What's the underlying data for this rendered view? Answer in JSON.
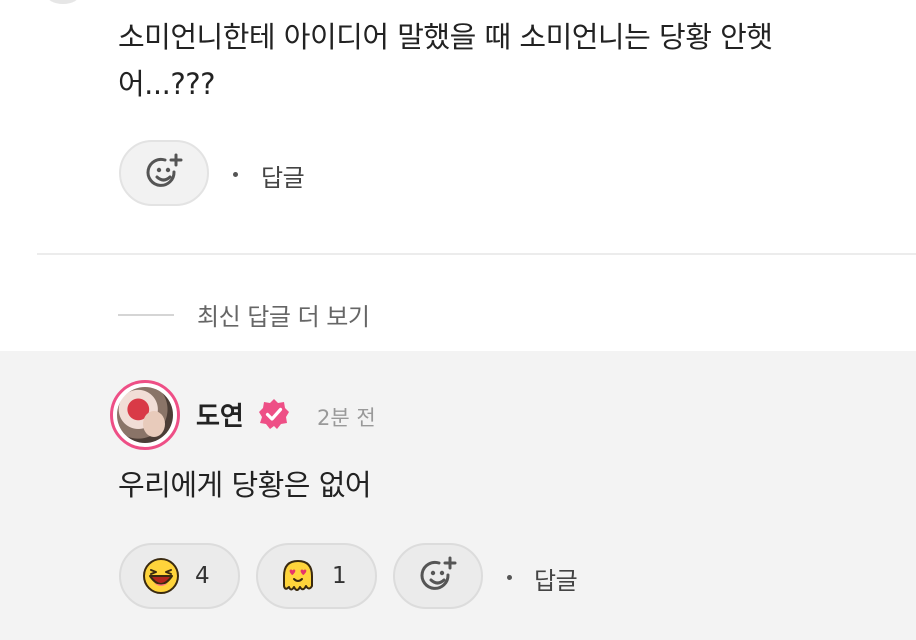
{
  "comment": {
    "text": "소미언니한테 아이디어 말했을 때 소미언니는 당황 안햇어...???",
    "add_reaction_icon": "smile-plus-icon",
    "reply_label": "답글"
  },
  "more_replies": {
    "label": "최신 답글 더 보기"
  },
  "reply": {
    "author": "도연",
    "verified_icon": "verified-badge-icon",
    "time": "2분 전",
    "text": "우리에게 당황은 없어",
    "reactions": [
      {
        "icon": "laughing-face-icon",
        "count": "4"
      },
      {
        "icon": "heart-eyes-ghost-icon",
        "count": "1"
      }
    ],
    "add_reaction_icon": "smile-plus-icon",
    "reply_label": "답글"
  },
  "colors": {
    "accent": "#ee4f86",
    "reply_background": "#f3f3f3",
    "emoji_yellow": "#ffd43b"
  }
}
